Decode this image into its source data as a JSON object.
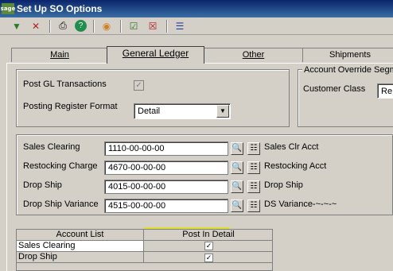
{
  "window": {
    "logo_text": "sage",
    "title": "Set Up SO Options"
  },
  "toolbar": {
    "icons": [
      "accept-icon",
      "cancel-icon",
      "print-icon",
      "help-icon",
      "color-wheel-icon",
      "check-grid-icon",
      "cross-grid-icon",
      "list-icon"
    ]
  },
  "tabs": [
    {
      "label": "Main"
    },
    {
      "label": "General Ledger"
    },
    {
      "label": "Other"
    },
    {
      "label": "Shipments"
    }
  ],
  "gl_options": {
    "post_gl_label": "Post GL Transactions",
    "post_gl_checked": "✓",
    "posting_register_label": "Posting Register Format",
    "posting_register_value": "Detail"
  },
  "override": {
    "group_title": "Account Override Segme",
    "customer_class_label": "Customer Class",
    "customer_class_value": "Re"
  },
  "accounts": [
    {
      "label": "Sales Clearing",
      "value": "1110-00-00-00",
      "desc": "Sales Clr Acct"
    },
    {
      "label": "Restocking Charge",
      "value": "4670-00-00-00",
      "desc": "Restocking Acct"
    },
    {
      "label": "Drop Ship",
      "value": "4015-00-00-00",
      "desc": "Drop Ship"
    },
    {
      "label": "Drop Ship Variance",
      "value": "4515-00-00-00",
      "desc": "DS Variance-~-~-~"
    }
  ],
  "grid": {
    "col1": "Account List",
    "col2": "Post In Detail",
    "rows": [
      {
        "account": "Sales Clearing",
        "checked": "✓"
      },
      {
        "account": "Drop Ship",
        "checked": "✓"
      }
    ]
  },
  "colors": {
    "highlight": "#e6e600",
    "title_bar": "#0a246a",
    "face": "#d4d0c8"
  }
}
